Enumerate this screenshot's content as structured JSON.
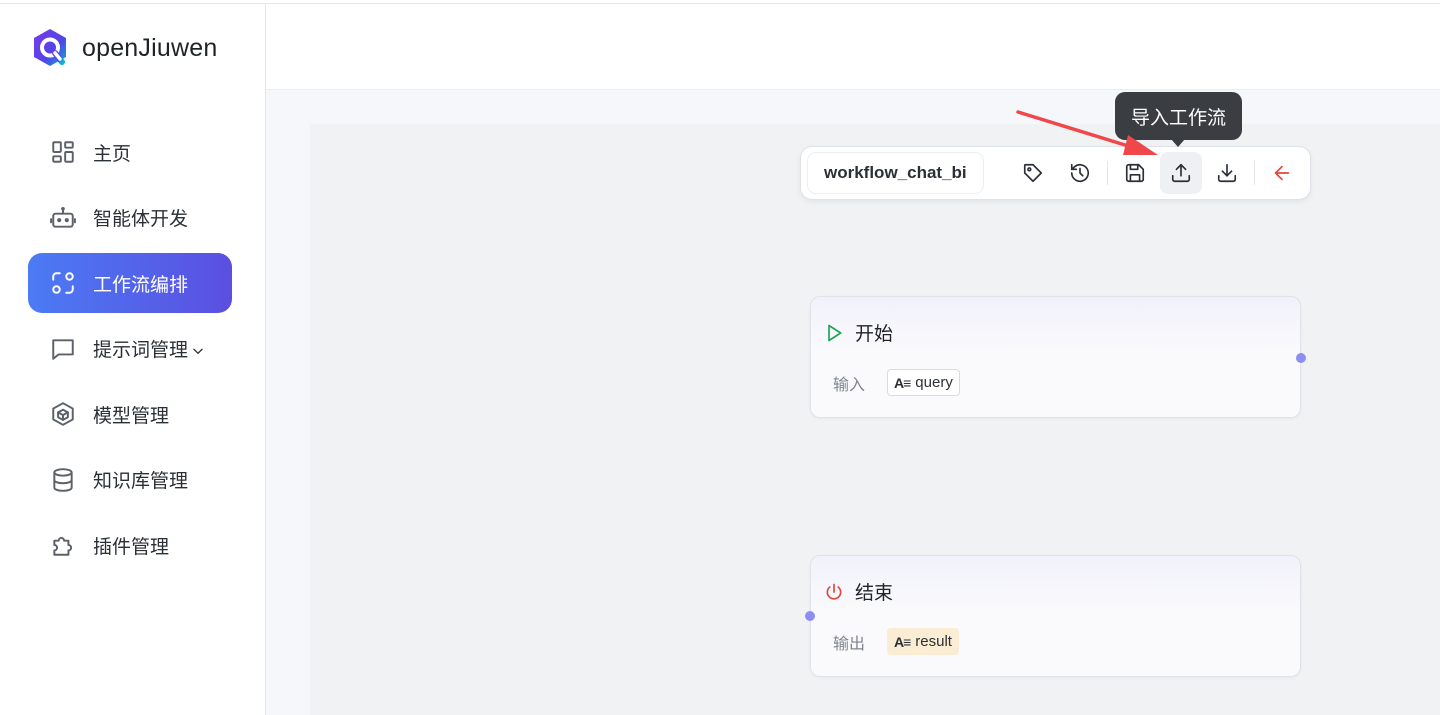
{
  "app": {
    "name": "openJiuwen"
  },
  "sidebar": {
    "items": [
      {
        "label": "主页",
        "icon": "dashboard-icon"
      },
      {
        "label": "智能体开发",
        "icon": "robot-icon"
      },
      {
        "label": "工作流编排",
        "icon": "workflow-icon",
        "active": true
      },
      {
        "label": "提示词管理",
        "icon": "chat-bubble-icon",
        "expandable": true
      },
      {
        "label": "模型管理",
        "icon": "cube-icon"
      },
      {
        "label": "知识库管理",
        "icon": "database-icon"
      },
      {
        "label": "插件管理",
        "icon": "puzzle-icon"
      }
    ]
  },
  "toolbar": {
    "workflow_name": "workflow_chat_bi",
    "buttons": [
      "tag-icon",
      "history-icon",
      "save-icon",
      "upload-icon",
      "download-icon",
      "back-arrow-icon"
    ],
    "tooltip": "导入工作流"
  },
  "nodes": {
    "start": {
      "title": "开始",
      "row_label": "输入",
      "param": "query",
      "param_icon": "A≡"
    },
    "end": {
      "title": "结束",
      "row_label": "输出",
      "param": "result",
      "param_icon": "A≡"
    }
  },
  "colors": {
    "accent": "#4b7bf5",
    "accent_end": "#5b4fe0",
    "start_icon": "#1ca45a",
    "end_icon": "#e2463d",
    "port": "#8d8ff0",
    "annotation_arrow": "#f0474b"
  }
}
